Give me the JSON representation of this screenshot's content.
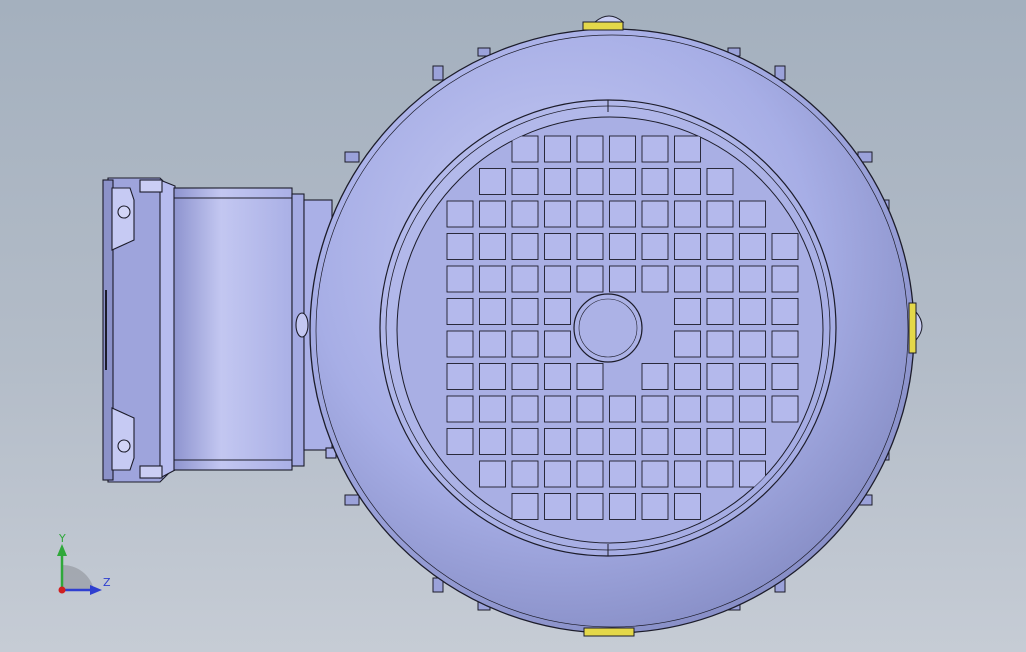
{
  "viewport": {
    "background_top": "#a4b0be",
    "background_bottom": "#c6ccd5"
  },
  "model": {
    "body_color": "#a7aee6",
    "edge_color": "#1c1c2a",
    "highlight_color": "#d9dcf6",
    "terminal_box_color": "#b4b9ea",
    "marker_color": "#e4d84a"
  },
  "triad": {
    "y_label": "Y",
    "z_label": "Z",
    "y_color": "#2fa83a",
    "z_color": "#2f3fd0",
    "x_color": "#d02020"
  }
}
